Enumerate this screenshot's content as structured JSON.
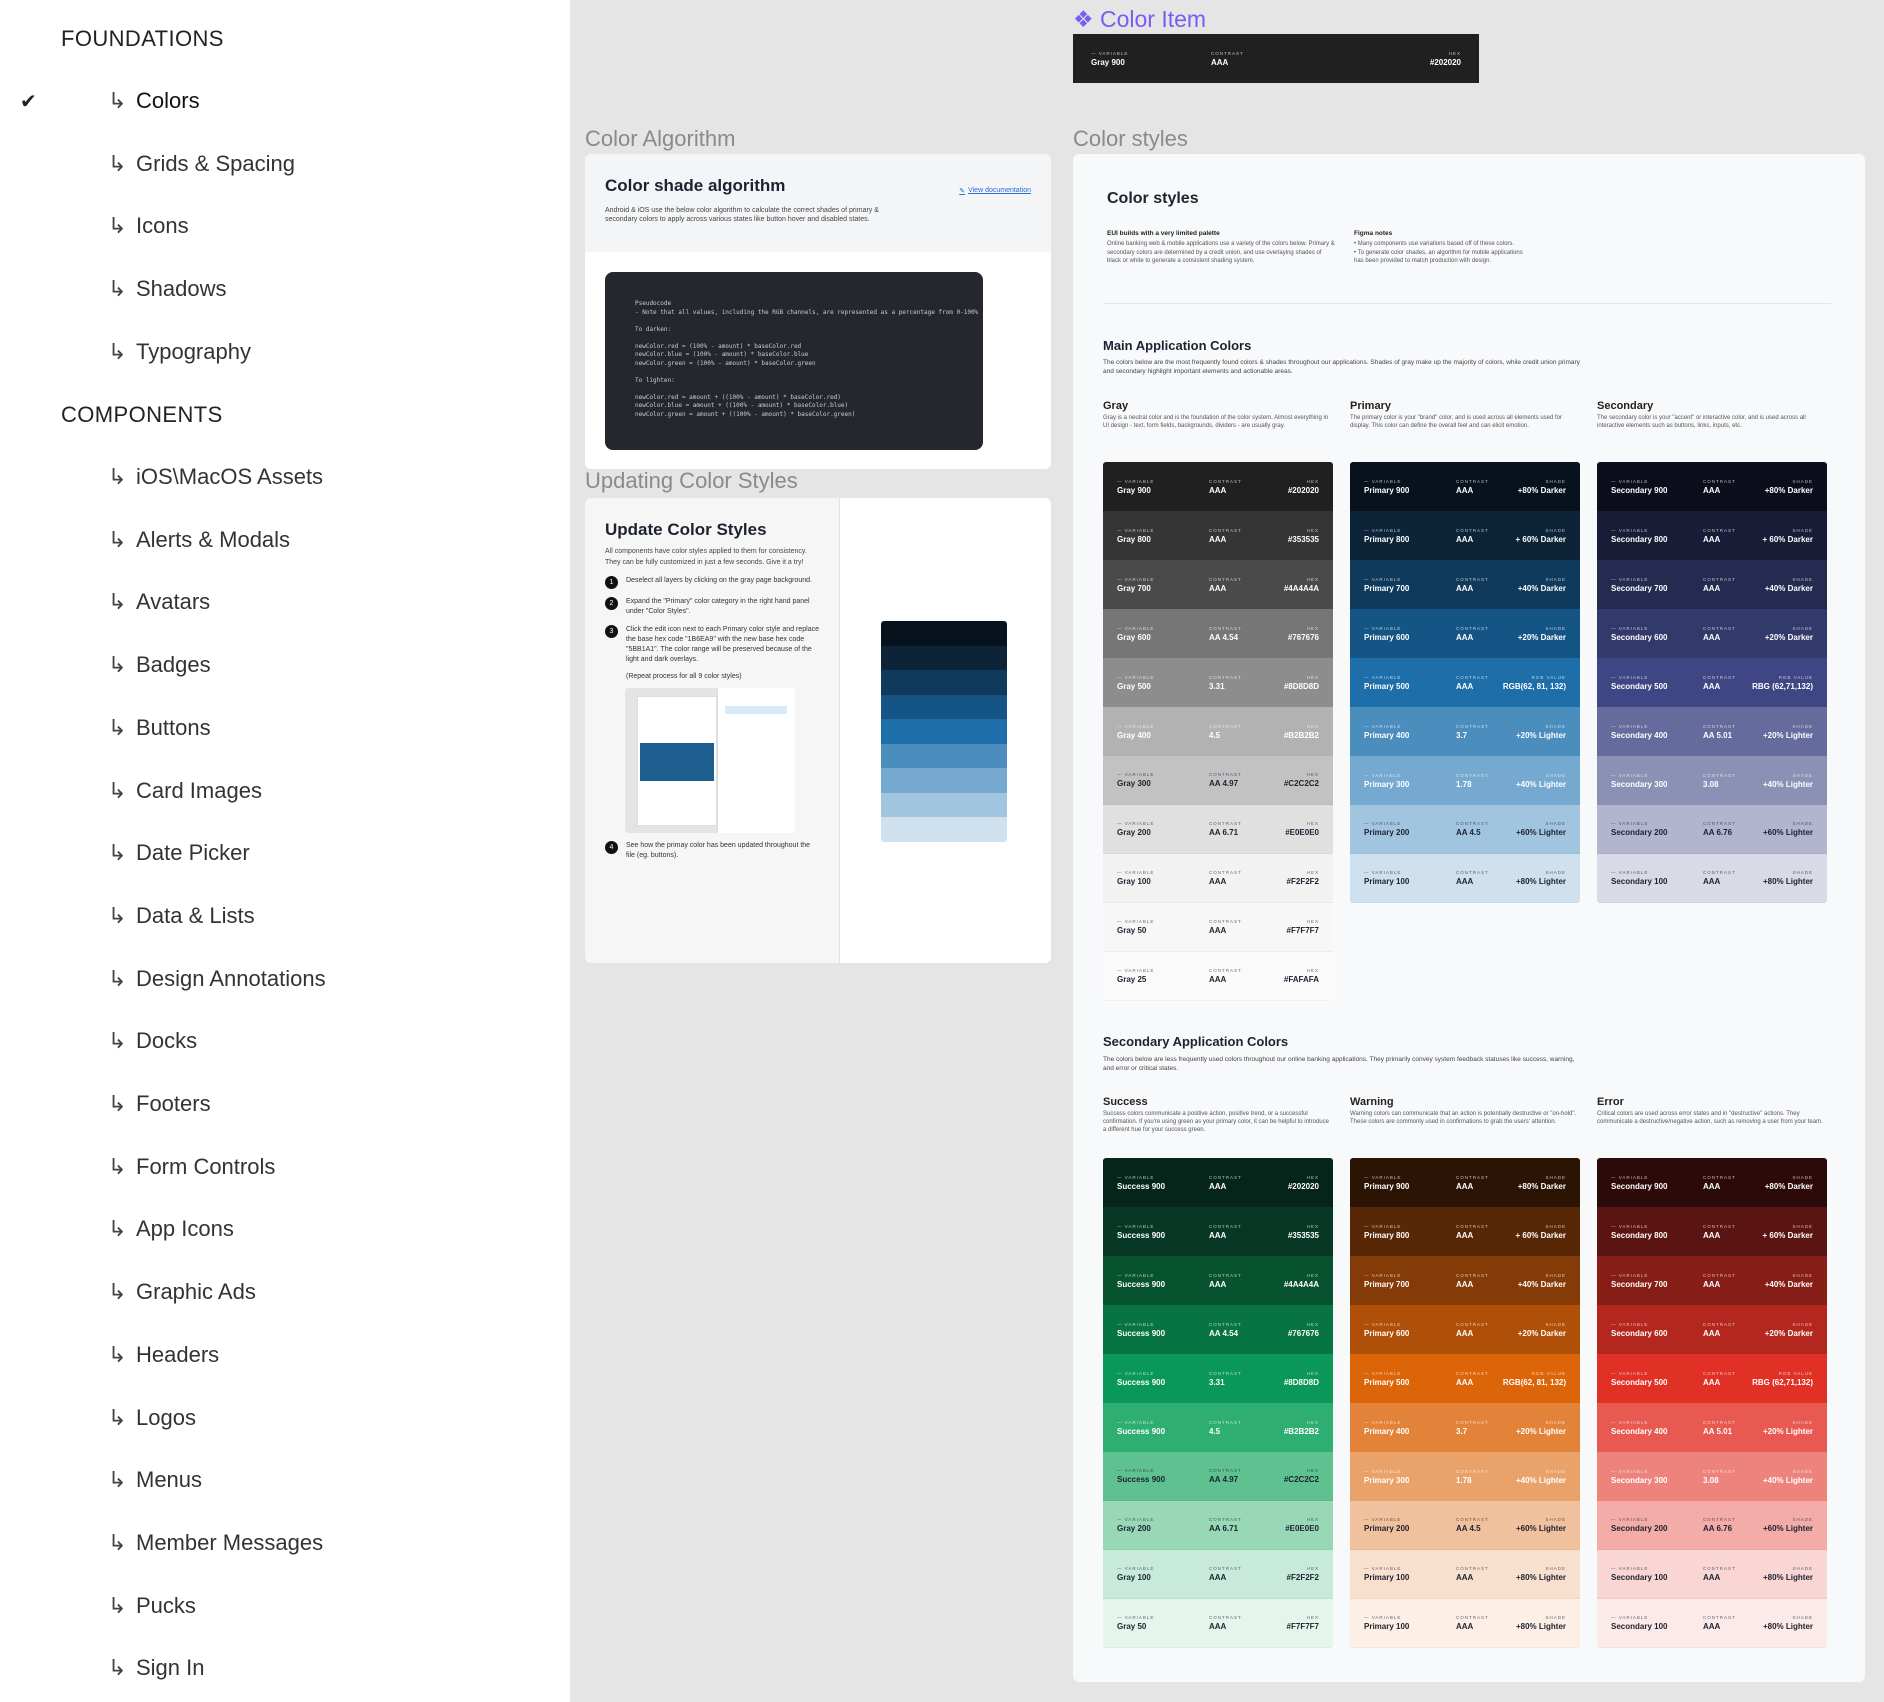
{
  "sidebar": {
    "foundations_label": "FOUNDATIONS",
    "components_label": "COMPONENTS",
    "arrow_glyph": "↳",
    "check_glyph": "✔",
    "foundations": [
      "Colors",
      "Grids & Spacing",
      "Icons",
      "Shadows",
      "Typography"
    ],
    "components": [
      "iOS\\MacOS Assets",
      "Alerts & Modals",
      "Avatars",
      "Badges",
      "Buttons",
      "Card Images",
      "Date Picker",
      "Data & Lists",
      "Design Annotations",
      "Docks",
      "Footers",
      "Form Controls",
      "App Icons",
      "Graphic Ads",
      "Headers",
      "Logos",
      "Menus",
      "Member Messages",
      "Pucks",
      "Sign In"
    ],
    "active_item": "Colors"
  },
  "color_item": {
    "title": "❖ Color Item",
    "variable_label": "— VARIABLE",
    "variable": "Gray 900",
    "contrast_label": "CONTRAST",
    "contrast": "AAA",
    "hex_label": "HEX",
    "hex": "#202020",
    "accent": "#7b5cf0"
  },
  "algorithm": {
    "section_label": "Color Algorithm",
    "title": "Color shade algorithm",
    "doc_link": "View documentation",
    "desc": "Android & iOS use the below color algorithm to calculate the correct shades of primary & secondary colors to apply across various states like button hover and disabled states.",
    "code": "Pseudocode\n- Note that all values, including the RGB channels, are represented as a percentage from 0-100%\n\nTo darken:\n\nnewColor.red = (100% - amount) * baseColor.red\nnewColor.blue = (100% - amount) * baseColor.blue\nnewColor.green = (100% - amount) * baseColor.green\n\nTo lighten:\n\nnewColor.red = amount + ((100% - amount) * baseColor.red)\nnewColor.blue = amount + ((100% - amount) * baseColor.blue)\nnewColor.green = amount + ((100% - amount) * baseColor.green)"
  },
  "updating": {
    "section_label": "Updating Color Styles",
    "title": "Update Color Styles",
    "intro": "All components have color styles applied to them for consistency. They can be fully customized in just a few seconds. Give it a try!",
    "steps": [
      {
        "n": "1",
        "text": "Deselect all layers by clicking on the gray page background."
      },
      {
        "n": "2",
        "text": "Expand the \"Primary\" color category in the right hand panel under \"Color Styles\"."
      },
      {
        "n": "3",
        "text": "Click the edit icon next to each Primary color style and replace the base hex code \"1B6EA9\" with the new base hex code \"5BB1A1\". The color range will be preserved because of the light and dark overlays."
      },
      {
        "n": "4",
        "text": "See how the primay color has been updated throughout the file (eg. buttons)."
      }
    ],
    "repeat_note": "(Repeat process for all 9 color styles)",
    "preview_colors": [
      "#08121c",
      "#0c2338",
      "#0f3a5c",
      "#155585",
      "#1d6ea9",
      "#4b8dbd",
      "#75a9cf",
      "#a2c5df",
      "#cfe1ee"
    ]
  },
  "styles": {
    "section_label": "Color styles",
    "title": "Color styles",
    "eui_title": "EUI builds with a very limited palette",
    "eui_text": "Online banking web & mobile applications use a variety of the colors below. Primary & secondary colors are determined by a credit union, and use overlaying shades of black or white to generate a consistent shading system.",
    "figma_title": "Figma notes",
    "figma_text": "• Many components use variations based off of these colors.\n• To generate color shades, an algorithm for mobile applications has been provided to match production with design.",
    "main_title": "Main Application Colors",
    "main_desc": "The colors below are the most frequently found colors & shades throughout our applications. Shades of gray make up the majority of colors, while credit union primary and secondary highlight important elements and actionable areas.",
    "secondary_title": "Secondary Application Colors",
    "secondary_desc": "The colors below are less frequently used colors throughout our online banking applications. They primarily convey system feedback statuses like success, warning, and error or critical states.",
    "labels": {
      "variable": "— VARIABLE",
      "contrast": "CONTRAST",
      "hex": "HEX",
      "shade": "SHADE",
      "rgb": "RGB VALUE"
    },
    "columns": [
      {
        "title": "Gray",
        "desc": "Gray is a neutral color and is the foundation of the color system. Almost everything in UI design - text, form fields, backgrounds, dividers - are usually gray.",
        "rows": [
          {
            "name": "Gray 900",
            "contrast": "AAA",
            "val": "#202020",
            "kind": "hex",
            "bg": "#202020",
            "dark": true
          },
          {
            "name": "Gray 800",
            "contrast": "AAA",
            "val": "#353535",
            "kind": "hex",
            "bg": "#353535",
            "dark": true
          },
          {
            "name": "Gray 700",
            "contrast": "AAA",
            "val": "#4A4A4A",
            "kind": "hex",
            "bg": "#4a4a4a",
            "dark": true
          },
          {
            "name": "Gray 600",
            "contrast": "AA 4.54",
            "val": "#767676",
            "kind": "hex",
            "bg": "#767676",
            "dark": true
          },
          {
            "name": "Gray 500",
            "contrast": "3.31",
            "val": "#8D8D8D",
            "kind": "hex",
            "bg": "#8d8d8d",
            "dark": true
          },
          {
            "name": "Gray 400",
            "contrast": "4.5",
            "val": "#B2B2B2",
            "kind": "hex",
            "bg": "#b2b2b2",
            "dark": true
          },
          {
            "name": "Gray 300",
            "contrast": "AA 4.97",
            "val": "#C2C2C2",
            "kind": "hex",
            "bg": "#c2c2c2",
            "dark": false
          },
          {
            "name": "Gray 200",
            "contrast": "AA 6.71",
            "val": "#E0E0E0",
            "kind": "hex",
            "bg": "#e0e0e0",
            "dark": false
          },
          {
            "name": "Gray 100",
            "contrast": "AAA",
            "val": "#F2F2F2",
            "kind": "hex",
            "bg": "#f2f2f2",
            "dark": false
          },
          {
            "name": "Gray 50",
            "contrast": "AAA",
            "val": "#F7F7F7",
            "kind": "hex",
            "bg": "#f7f7f7",
            "dark": false
          },
          {
            "name": "Gray 25",
            "contrast": "AAA",
            "val": "#FAFAFA",
            "kind": "hex",
            "bg": "#fafafa",
            "dark": false
          }
        ]
      },
      {
        "title": "Primary",
        "desc": "The primary color is your \"brand\" color, and is used across all elements used for display. This color can define the overall feel and can elicit emotion.",
        "rows": [
          {
            "name": "Primary 900",
            "contrast": "AAA",
            "val": "+80% Darker",
            "kind": "shade",
            "bg": "#08121c",
            "dark": true
          },
          {
            "name": "Primary 800",
            "contrast": "AAA",
            "val": "+ 60% Darker",
            "kind": "shade",
            "bg": "#0c2338",
            "dark": true
          },
          {
            "name": "Primary 700",
            "contrast": "AAA",
            "val": "+40% Darker",
            "kind": "shade",
            "bg": "#0f3a5c",
            "dark": true
          },
          {
            "name": "Primary 600",
            "contrast": "AAA",
            "val": "+20% Darker",
            "kind": "shade",
            "bg": "#155585",
            "dark": true
          },
          {
            "name": "Primary 500",
            "contrast": "AAA",
            "val": "RGB(62, 81, 132)",
            "kind": "rgb",
            "bg": "#1d6ea9",
            "dark": true
          },
          {
            "name": "Primary 400",
            "contrast": "3.7",
            "val": "+20% Lighter",
            "kind": "shade",
            "bg": "#4b8dbd",
            "dark": true
          },
          {
            "name": "Primary 300",
            "contrast": "1.78",
            "val": "+40% Lighter",
            "kind": "shade",
            "bg": "#75a9cf",
            "dark": true
          },
          {
            "name": "Primary 200",
            "contrast": "AA 4.5",
            "val": "+60% Lighter",
            "kind": "shade",
            "bg": "#a2c5df",
            "dark": false
          },
          {
            "name": "Primary 100",
            "contrast": "AAA",
            "val": "+80% Lighter",
            "kind": "shade",
            "bg": "#cfe1ee",
            "dark": false
          }
        ]
      },
      {
        "title": "Secondary",
        "desc": "The secondary color is your \"accent\" or interactive color, and is used across all interactive elements such as buttons, links, inputs, etc.",
        "rows": [
          {
            "name": "Secondary 900",
            "contrast": "AAA",
            "val": "+80% Darker",
            "kind": "shade",
            "bg": "#0c0e1b",
            "dark": true
          },
          {
            "name": "Secondary 800",
            "contrast": "AAA",
            "val": "+ 60% Darker",
            "kind": "shade",
            "bg": "#181c36",
            "dark": true
          },
          {
            "name": "Secondary 700",
            "contrast": "AAA",
            "val": "+40% Darker",
            "kind": "shade",
            "bg": "#252a51",
            "dark": true
          },
          {
            "name": "Secondary 600",
            "contrast": "AAA",
            "val": "+20% Darker",
            "kind": "shade",
            "bg": "#32396b",
            "dark": true
          },
          {
            "name": "Secondary 500",
            "contrast": "AAA",
            "val": "RBG (62,71,132)",
            "kind": "rgb",
            "bg": "#3e4784",
            "dark": true
          },
          {
            "name": "Secondary 400",
            "contrast": "AA 5.01",
            "val": "+20% Lighter",
            "kind": "shade",
            "bg": "#656c9d",
            "dark": true
          },
          {
            "name": "Secondary 300",
            "contrast": "3.08",
            "val": "+40% Lighter",
            "kind": "shade",
            "bg": "#8b91b5",
            "dark": true
          },
          {
            "name": "Secondary 200",
            "contrast": "AA 6.76",
            "val": "+60% Lighter",
            "kind": "shade",
            "bg": "#b2b5ce",
            "dark": false
          },
          {
            "name": "Secondary 100",
            "contrast": "AAA",
            "val": "+80% Lighter",
            "kind": "shade",
            "bg": "#d8dae6",
            "dark": false
          }
        ]
      },
      {
        "title": "Success",
        "desc": "Success colors communicate a positive action, positive trend, or a successful confirmation. If you're using green as your primary color, it can be helpful to introduce a different hue for your success green.",
        "rows": [
          {
            "name": "Success 900",
            "contrast": "AAA",
            "val": "#202020",
            "kind": "hex",
            "bg": "#06251a",
            "dark": true
          },
          {
            "name": "Success 900",
            "contrast": "AAA",
            "val": "#353535",
            "kind": "hex",
            "bg": "#073825",
            "dark": true
          },
          {
            "name": "Success 900",
            "contrast": "AAA",
            "val": "#4A4A4A",
            "kind": "hex",
            "bg": "#075330",
            "dark": true
          },
          {
            "name": "Success 900",
            "contrast": "AA 4.54",
            "val": "#767676",
            "kind": "hex",
            "bg": "#087443",
            "dark": true
          },
          {
            "name": "Success 900",
            "contrast": "3.31",
            "val": "#8D8D8D",
            "kind": "hex",
            "bg": "#0b9757",
            "dark": true
          },
          {
            "name": "Success 900",
            "contrast": "4.5",
            "val": "#B2B2B2",
            "kind": "hex",
            "bg": "#2fae71",
            "dark": true
          },
          {
            "name": "Success 900",
            "contrast": "AA 4.97",
            "val": "#C2C2C2",
            "kind": "hex",
            "bg": "#5fc190",
            "dark": false
          },
          {
            "name": "Gray 200",
            "contrast": "AA 6.71",
            "val": "#E0E0E0",
            "kind": "hex",
            "bg": "#98d8b7",
            "dark": false
          },
          {
            "name": "Gray 100",
            "contrast": "AAA",
            "val": "#F2F2F2",
            "kind": "hex",
            "bg": "#c8eadb",
            "dark": false
          },
          {
            "name": "Gray 50",
            "contrast": "AAA",
            "val": "#F7F7F7",
            "kind": "hex",
            "bg": "#e4f5ec",
            "dark": false
          }
        ]
      },
      {
        "title": "Warning",
        "desc": "Warning colors can communicate that an action is potentially destructive or \"on-hold\". These colors are commonly used in confirmations to grab the users' attention.",
        "rows": [
          {
            "name": "Primary 900",
            "contrast": "AAA",
            "val": "+80% Darker",
            "kind": "shade",
            "bg": "#2c1404",
            "dark": true
          },
          {
            "name": "Primary 800",
            "contrast": "AAA",
            "val": "+ 60% Darker",
            "kind": "shade",
            "bg": "#582806",
            "dark": true
          },
          {
            "name": "Primary 700",
            "contrast": "AAA",
            "val": "+40% Darker",
            "kind": "shade",
            "bg": "#843b07",
            "dark": true
          },
          {
            "name": "Primary 600",
            "contrast": "AAA",
            "val": "+20% Darker",
            "kind": "shade",
            "bg": "#b04f08",
            "dark": true
          },
          {
            "name": "Primary 500",
            "contrast": "AAA",
            "val": "RGB(62, 81, 132)",
            "kind": "rgb",
            "bg": "#dc6409",
            "dark": true
          },
          {
            "name": "Primary 400",
            "contrast": "3.7",
            "val": "+20% Lighter",
            "kind": "shade",
            "bg": "#e3833a",
            "dark": true
          },
          {
            "name": "Primary 300",
            "contrast": "1.78",
            "val": "+40% Lighter",
            "kind": "shade",
            "bg": "#eaa26b",
            "dark": true
          },
          {
            "name": "Primary 200",
            "contrast": "AA 4.5",
            "val": "+60% Lighter",
            "kind": "shade",
            "bg": "#f1c19d",
            "dark": false
          },
          {
            "name": "Primary 100",
            "contrast": "AAA",
            "val": "+80% Lighter",
            "kind": "shade",
            "bg": "#f8e0ce",
            "dark": false
          },
          {
            "name": "Primary 100",
            "contrast": "AAA",
            "val": "+80% Lighter",
            "kind": "shade",
            "bg": "#fcefe6",
            "dark": false
          }
        ]
      },
      {
        "title": "Error",
        "desc": "Critical colors are used across error states and in \"destructive\" actions. They communicate a destructive/negative action, such as removing a user from your team.",
        "rows": [
          {
            "name": "Secondary 900",
            "contrast": "AAA",
            "val": "+80% Darker",
            "kind": "shade",
            "bg": "#2d0a0a",
            "dark": true
          },
          {
            "name": "Secondary 800",
            "contrast": "AAA",
            "val": "+ 60% Darker",
            "kind": "shade",
            "bg": "#5a1411",
            "dark": true
          },
          {
            "name": "Secondary 700",
            "contrast": "AAA",
            "val": "+40% Darker",
            "kind": "shade",
            "bg": "#871d17",
            "dark": true
          },
          {
            "name": "Secondary 600",
            "contrast": "AAA",
            "val": "+20% Darker",
            "kind": "shade",
            "bg": "#b4271e",
            "dark": true
          },
          {
            "name": "Secondary 500",
            "contrast": "AAA",
            "val": "RBG (62,71,132)",
            "kind": "rgb",
            "bg": "#e13025",
            "dark": true
          },
          {
            "name": "Secondary 400",
            "contrast": "AA 5.01",
            "val": "+20% Lighter",
            "kind": "shade",
            "bg": "#e75951",
            "dark": true
          },
          {
            "name": "Secondary 300",
            "contrast": "3.08",
            "val": "+40% Lighter",
            "kind": "shade",
            "bg": "#ed837c",
            "dark": true
          },
          {
            "name": "Secondary 200",
            "contrast": "AA 6.76",
            "val": "+60% Lighter",
            "kind": "shade",
            "bg": "#f3aca8",
            "dark": false
          },
          {
            "name": "Secondary 100",
            "contrast": "AAA",
            "val": "+80% Lighter",
            "kind": "shade",
            "bg": "#f9d6d3",
            "dark": false
          },
          {
            "name": "Secondary 100",
            "contrast": "AAA",
            "val": "+80% Lighter",
            "kind": "shade",
            "bg": "#fceae9",
            "dark": false
          }
        ]
      }
    ]
  }
}
